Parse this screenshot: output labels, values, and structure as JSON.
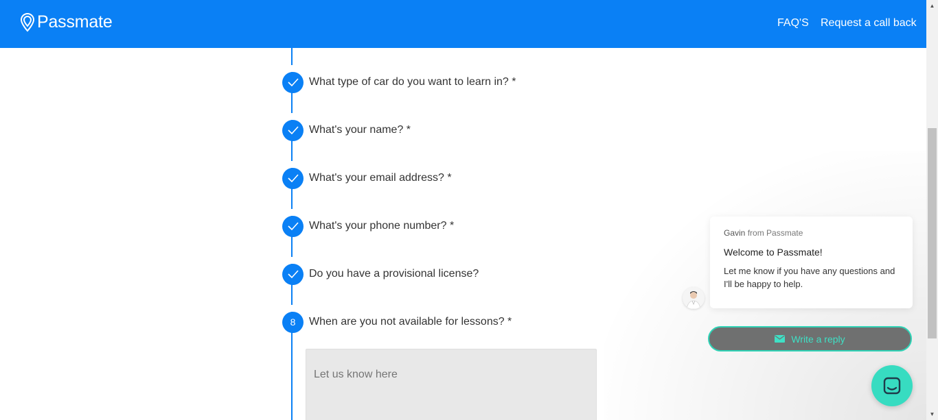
{
  "header": {
    "logo_text": "Passmate",
    "nav": [
      {
        "label": "FAQ'S"
      },
      {
        "label": "Request a call back"
      }
    ],
    "background_color": "#0a80f5"
  },
  "form": {
    "steps": [
      {
        "status": "complete",
        "icon": "check-icon",
        "question": "What type of car do you want to learn in? *"
      },
      {
        "status": "complete",
        "icon": "check-icon",
        "question": "What's your name? *"
      },
      {
        "status": "complete",
        "icon": "check-icon",
        "question": "What's your email address? *"
      },
      {
        "status": "complete",
        "icon": "check-icon",
        "question": "What's your phone number? *"
      },
      {
        "status": "complete",
        "icon": "check-icon",
        "question": "Do you have a provisional license?"
      },
      {
        "status": "current",
        "number": "8",
        "question": "When are you not available for lessons? *"
      }
    ],
    "availability_input": {
      "placeholder": "Let us know here",
      "value": ""
    }
  },
  "chat": {
    "sender_name": "Gavin",
    "sender_suffix": "from Passmate",
    "welcome": "Welcome to Passmate!",
    "message": "Let me know if you have any questions and I'll be happy to help.",
    "reply_label": "Write a reply",
    "accent_color": "#37dcc1"
  }
}
